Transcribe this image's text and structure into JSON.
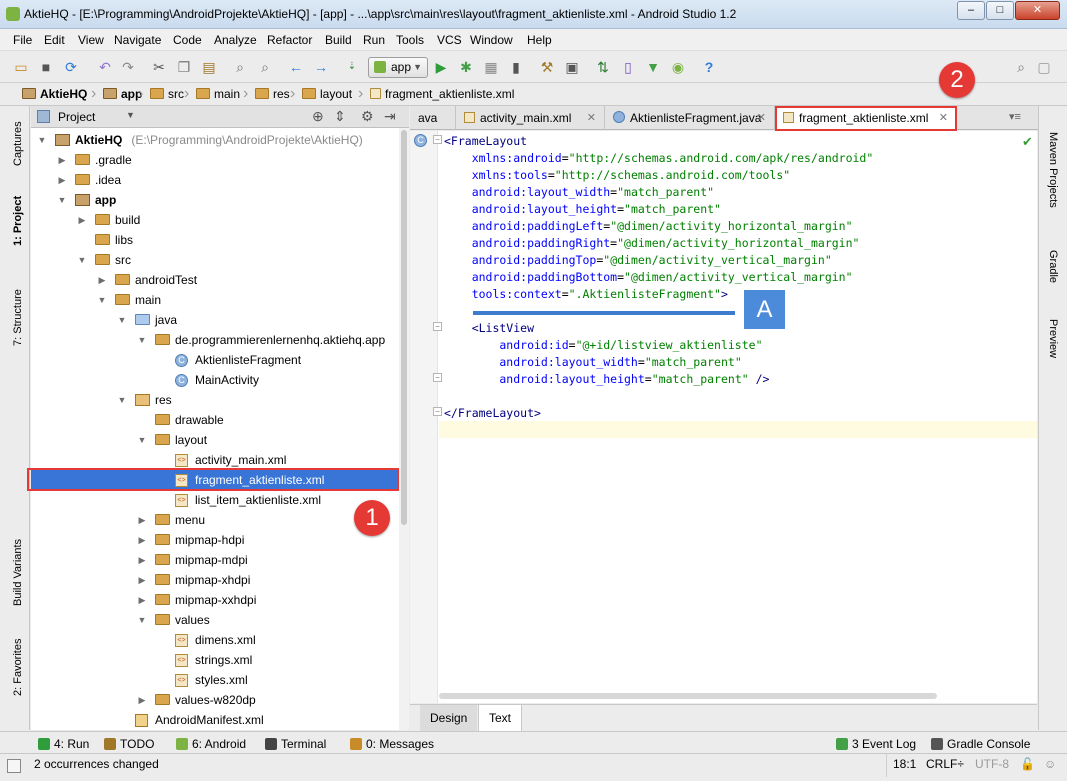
{
  "window": {
    "title": "AktieHQ - [E:\\Programming\\AndroidProjekte\\AktieHQ] - [app] - ...\\app\\src\\main\\res\\layout\\fragment_aktienliste.xml - Android Studio 1.2",
    "controls": [
      "–",
      "□",
      "✕"
    ]
  },
  "menu": [
    "File",
    "Edit",
    "View",
    "Navigate",
    "Code",
    "Analyze",
    "Refactor",
    "Build",
    "Run",
    "Tools",
    "VCS",
    "Window",
    "Help"
  ],
  "toolbar": {
    "run_config": "app"
  },
  "breadcrumbs": [
    "AktieHQ",
    "app",
    "src",
    "main",
    "res",
    "layout",
    "fragment_aktienliste.xml"
  ],
  "project_panel": {
    "view_selector": "Project",
    "tree": [
      {
        "label": "AktieHQ",
        "suffix": " (E:\\Programming\\AndroidProjekte\\AktieHQ)",
        "icon": "module",
        "depth": 0,
        "state": "open",
        "bold": true
      },
      {
        "label": ".gradle",
        "icon": "folder",
        "depth": 1,
        "state": "closed"
      },
      {
        "label": ".idea",
        "icon": "folder",
        "depth": 1,
        "state": "closed"
      },
      {
        "label": "app",
        "icon": "module",
        "depth": 1,
        "state": "open",
        "bold": true
      },
      {
        "label": "build",
        "icon": "folder",
        "depth": 2,
        "state": "closed"
      },
      {
        "label": "libs",
        "icon": "folder",
        "depth": 2,
        "state": "none"
      },
      {
        "label": "src",
        "icon": "folder",
        "depth": 2,
        "state": "open"
      },
      {
        "label": "androidTest",
        "icon": "folder",
        "depth": 3,
        "state": "closed"
      },
      {
        "label": "main",
        "icon": "folder",
        "depth": 3,
        "state": "open"
      },
      {
        "label": "java",
        "icon": "src",
        "depth": 4,
        "state": "open"
      },
      {
        "label": "de.programmierenlernenhq.aktiehq.app",
        "icon": "folder",
        "depth": 5,
        "state": "open"
      },
      {
        "label": "AktienlisteFragment",
        "icon": "class",
        "depth": 6,
        "state": "none"
      },
      {
        "label": "MainActivity",
        "icon": "class",
        "depth": 6,
        "state": "none"
      },
      {
        "label": "res",
        "icon": "res",
        "depth": 4,
        "state": "open"
      },
      {
        "label": "drawable",
        "icon": "folder",
        "depth": 5,
        "state": "none"
      },
      {
        "label": "layout",
        "icon": "folder",
        "depth": 5,
        "state": "open"
      },
      {
        "label": "activity_main.xml",
        "icon": "xml",
        "depth": 6,
        "state": "none"
      },
      {
        "label": "fragment_aktienliste.xml",
        "icon": "xml",
        "depth": 6,
        "state": "none",
        "selected": true
      },
      {
        "label": "list_item_aktienliste.xml",
        "icon": "xml",
        "depth": 6,
        "state": "none"
      },
      {
        "label": "menu",
        "icon": "folder",
        "depth": 5,
        "state": "closed"
      },
      {
        "label": "mipmap-hdpi",
        "icon": "folder",
        "depth": 5,
        "state": "closed"
      },
      {
        "label": "mipmap-mdpi",
        "icon": "folder",
        "depth": 5,
        "state": "closed"
      },
      {
        "label": "mipmap-xhdpi",
        "icon": "folder",
        "depth": 5,
        "state": "closed"
      },
      {
        "label": "mipmap-xxhdpi",
        "icon": "folder",
        "depth": 5,
        "state": "closed"
      },
      {
        "label": "values",
        "icon": "folder",
        "depth": 5,
        "state": "open"
      },
      {
        "label": "dimens.xml",
        "icon": "xml",
        "depth": 6,
        "state": "none"
      },
      {
        "label": "strings.xml",
        "icon": "xml",
        "depth": 6,
        "state": "none"
      },
      {
        "label": "styles.xml",
        "icon": "xml",
        "depth": 6,
        "state": "none"
      },
      {
        "label": "values-w820dp",
        "icon": "folder",
        "depth": 5,
        "state": "closed"
      },
      {
        "label": "AndroidManifest.xml",
        "icon": "manifest",
        "depth": 4,
        "state": "none"
      }
    ]
  },
  "editor_tabs": [
    {
      "label": "ava",
      "icon": "none"
    },
    {
      "label": "activity_main.xml",
      "icon": "xml"
    },
    {
      "label": "AktienlisteFragment.java",
      "icon": "class"
    },
    {
      "label": "fragment_aktienliste.xml",
      "icon": "xml",
      "active": true
    }
  ],
  "code_lines": [
    [
      {
        "t": "<FrameLayout",
        "c": "tag"
      }
    ],
    [
      {
        "t": "    xmlns:android",
        "c": "attr"
      },
      {
        "t": "=",
        "c": "plain"
      },
      {
        "t": "\"http://schemas.android.com/apk/res/android\"",
        "c": "val"
      }
    ],
    [
      {
        "t": "    xmlns:tools",
        "c": "attr"
      },
      {
        "t": "=",
        "c": "plain"
      },
      {
        "t": "\"http://schemas.android.com/tools\"",
        "c": "val"
      }
    ],
    [
      {
        "t": "    android:layout_width",
        "c": "attr"
      },
      {
        "t": "=",
        "c": "plain"
      },
      {
        "t": "\"match_parent\"",
        "c": "val"
      }
    ],
    [
      {
        "t": "    android:layout_height",
        "c": "attr"
      },
      {
        "t": "=",
        "c": "plain"
      },
      {
        "t": "\"match_parent\"",
        "c": "val"
      }
    ],
    [
      {
        "t": "    android:paddingLeft",
        "c": "attr"
      },
      {
        "t": "=",
        "c": "plain"
      },
      {
        "t": "\"@dimen/activity_horizontal_margin\"",
        "c": "val"
      }
    ],
    [
      {
        "t": "    android:paddingRight",
        "c": "attr"
      },
      {
        "t": "=",
        "c": "plain"
      },
      {
        "t": "\"@dimen/activity_horizontal_margin\"",
        "c": "val"
      }
    ],
    [
      {
        "t": "    android:paddingTop",
        "c": "attr"
      },
      {
        "t": "=",
        "c": "plain"
      },
      {
        "t": "\"@dimen/activity_vertical_margin\"",
        "c": "val"
      }
    ],
    [
      {
        "t": "    android:paddingBottom",
        "c": "attr"
      },
      {
        "t": "=",
        "c": "plain"
      },
      {
        "t": "\"@dimen/activity_vertical_margin\"",
        "c": "val"
      }
    ],
    [
      {
        "t": "    tools:context",
        "c": "attr"
      },
      {
        "t": "=",
        "c": "plain"
      },
      {
        "t": "\".AktienlisteFragment\"",
        "c": "val"
      },
      {
        "t": ">",
        "c": "tag"
      }
    ],
    [],
    [
      {
        "t": "    <ListView",
        "c": "tag"
      }
    ],
    [
      {
        "t": "        android:id",
        "c": "attr"
      },
      {
        "t": "=",
        "c": "plain"
      },
      {
        "t": "\"@+id/listview_aktienliste\"",
        "c": "val"
      }
    ],
    [
      {
        "t": "        android:layout_width",
        "c": "attr"
      },
      {
        "t": "=",
        "c": "plain"
      },
      {
        "t": "\"match_parent\"",
        "c": "val"
      }
    ],
    [
      {
        "t": "        android:layout_height",
        "c": "attr"
      },
      {
        "t": "=",
        "c": "plain"
      },
      {
        "t": "\"match_parent\"",
        "c": "val"
      },
      {
        "t": " />",
        "c": "tag"
      }
    ],
    [],
    [
      {
        "t": "</FrameLayout>",
        "c": "tag"
      }
    ]
  ],
  "editor_bottom_tabs": [
    "Design",
    "Text"
  ],
  "bottom_tools": [
    {
      "label": "4: Run",
      "icon": "run-icon"
    },
    {
      "label": "TODO",
      "icon": "todo-icon"
    },
    {
      "label": "6: Android",
      "icon": "android-icon"
    },
    {
      "label": "Terminal",
      "icon": "terminal-icon"
    },
    {
      "label": "0: Messages",
      "icon": "messages-icon"
    },
    {
      "label": "3 Event Log",
      "icon": "event-log-icon"
    },
    {
      "label": "Gradle Console",
      "icon": "gradle-console-icon"
    }
  ],
  "left_strip": [
    "Captures",
    "1: Project",
    "7: Structure",
    "Build Variants",
    "2: Favorites"
  ],
  "right_strip": [
    "Maven Projects",
    "Gradle",
    "Preview"
  ],
  "status": {
    "message": "2 occurrences changed",
    "position": "18:1",
    "line_sep": "CRLF÷",
    "encoding": "UTF-8"
  },
  "annotations": {
    "marker1": "1",
    "marker2": "2",
    "markerA": "A"
  }
}
